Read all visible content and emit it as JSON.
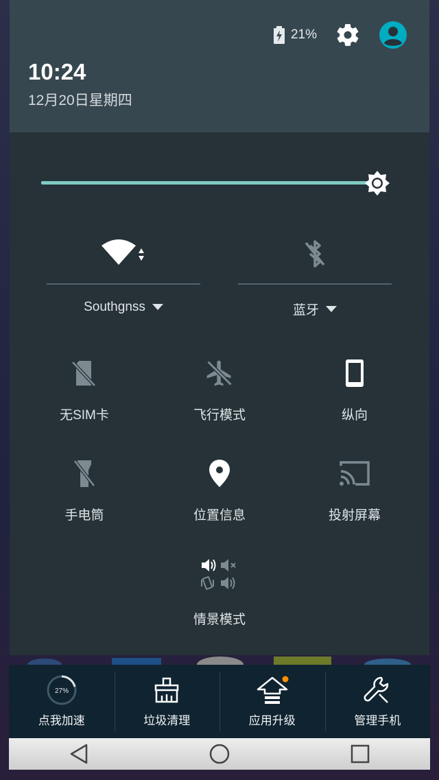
{
  "status": {
    "battery_text": "21%"
  },
  "clock": {
    "time": "10:24",
    "date": "12月20日星期四"
  },
  "brightness": {
    "level_percent": 92
  },
  "network": {
    "wifi_label": "Southgnss",
    "bluetooth_label": "蓝牙"
  },
  "tiles": [
    {
      "label": "无SIM卡",
      "icon": "no-sim-icon"
    },
    {
      "label": "飞行模式",
      "icon": "airplane-icon"
    },
    {
      "label": "纵向",
      "icon": "portrait-icon"
    },
    {
      "label": "手电筒",
      "icon": "flashlight-icon"
    },
    {
      "label": "位置信息",
      "icon": "location-icon"
    },
    {
      "label": "投射屏幕",
      "icon": "cast-icon"
    },
    {
      "label": "情景模式",
      "icon": "sound-profile-icon"
    }
  ],
  "dock": {
    "boost_percent": "27%",
    "items": [
      {
        "label": "点我加速",
        "icon": "boost-icon"
      },
      {
        "label": "垃圾清理",
        "icon": "broom-icon"
      },
      {
        "label": "应用升级",
        "icon": "upgrade-icon"
      },
      {
        "label": "管理手机",
        "icon": "wrench-icon"
      }
    ]
  },
  "colors": {
    "panel": "#263238",
    "header": "#37474f",
    "accent": "#80cbc4",
    "avatar": "#00acc1",
    "badge": "#ff8f00"
  }
}
